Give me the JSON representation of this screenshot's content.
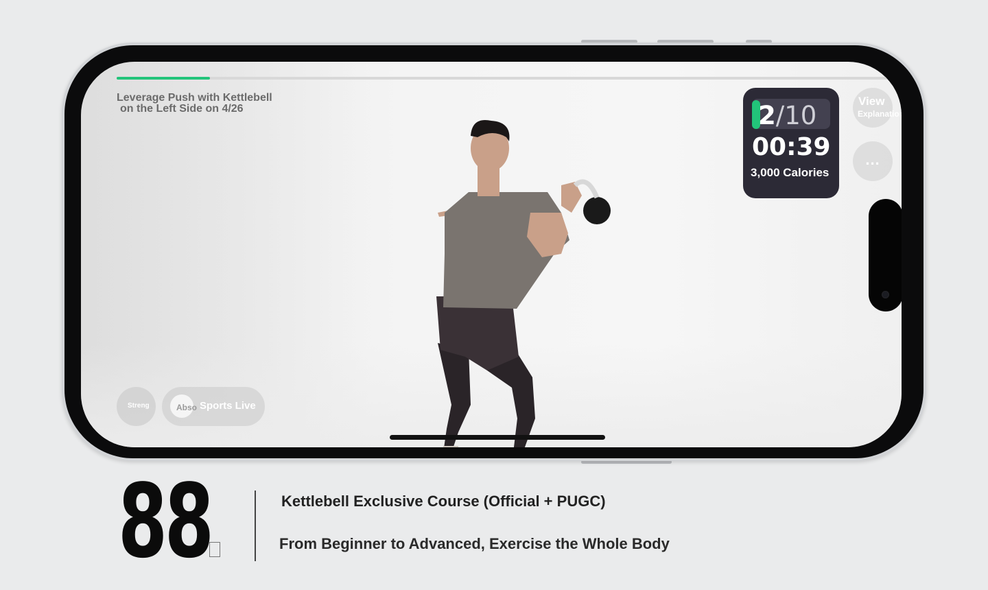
{
  "workout": {
    "exercise_title_line1": "Leverage Push with Kettlebell",
    "exercise_title_line2": "on the Left Side on 4/26",
    "progress_percent": 12,
    "rep_current": "2",
    "rep_separator": "/",
    "rep_total": "10",
    "timer": "00:39",
    "calories": "3,000 Calories"
  },
  "controls": {
    "view_label": "View",
    "view_sub_label": "Explanation",
    "more_label": "...",
    "strength_label": "Streng",
    "abs_label": "Abso",
    "sports_live_label": "Sports Live"
  },
  "promo": {
    "count": "88",
    "course_title": "Kettlebell Exclusive Course (Official + PUGC)",
    "course_subtitle": "From Beginner to Advanced, Exercise the Whole Body"
  },
  "colors": {
    "accent": "#22c47a",
    "card_bg": "#2c2a36",
    "phone_frame": "#0b0b0c"
  },
  "icons": {
    "more": "more-dots-icon",
    "camera": "camera-icon"
  }
}
